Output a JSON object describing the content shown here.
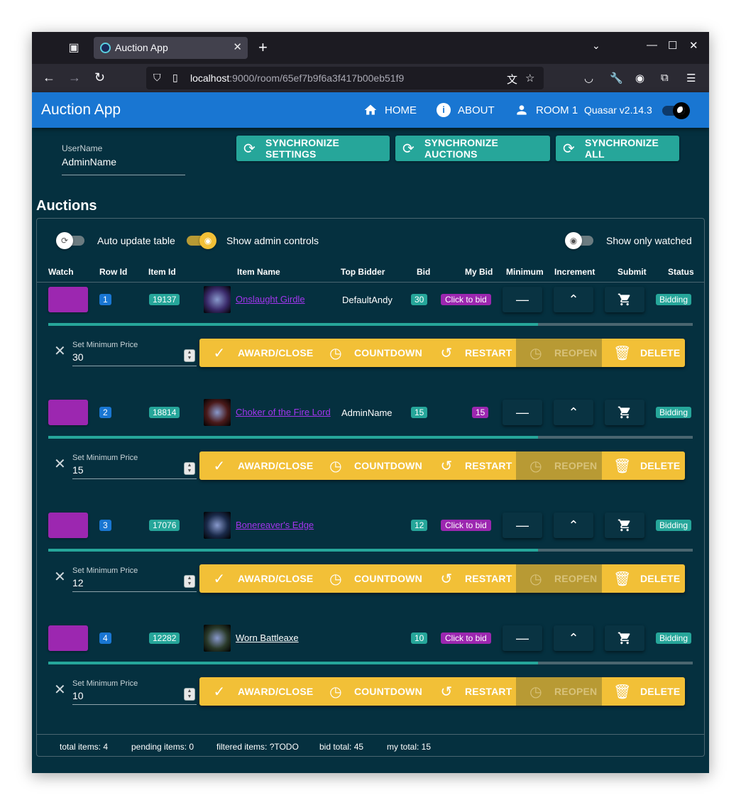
{
  "browser": {
    "tab_title": "Auction App",
    "url_host": "localhost",
    "url_rest": ":9000/room/65ef7b9f6a3f417b00eb51f9"
  },
  "header": {
    "title": "Auction App",
    "nav": {
      "home": "HOME",
      "about": "ABOUT",
      "room": "ROOM 1"
    },
    "version": "Quasar v2.14.3"
  },
  "user": {
    "label": "UserName",
    "value": "AdminName"
  },
  "sync": {
    "settings": "SYNCHRONIZE SETTINGS",
    "auctions": "SYNCHRONIZE AUCTIONS",
    "all": "SYNCHRONIZE ALL"
  },
  "section_title": "Auctions",
  "toggles": {
    "auto_update": "Auto update table",
    "show_admin": "Show admin controls",
    "only_watched": "Show only watched"
  },
  "columns": {
    "watch": "Watch",
    "row_id": "Row Id",
    "item_id": "Item Id",
    "item_name": "Item Name",
    "top_bidder": "Top Bidder",
    "bid": "Bid",
    "my_bid": "My Bid",
    "minimum": "Minimum",
    "increment": "Increment",
    "submit": "Submit",
    "status": "Status"
  },
  "rows": [
    {
      "row_id": "1",
      "item_id": "19137",
      "item_name": "Onslaught Girdle",
      "top_bidder": "DefaultAndy",
      "bid": "30",
      "my_bid": "Click to bid",
      "status": "Bidding",
      "min_label": "Set Minimum Price",
      "min_value": "30",
      "progress": 0.76
    },
    {
      "row_id": "2",
      "item_id": "18814",
      "item_name": "Choker of the Fire Lord",
      "top_bidder": "AdminName",
      "bid": "15",
      "my_bid": "15",
      "status": "Bidding",
      "min_label": "Set Minimum Price",
      "min_value": "15",
      "progress": 0.76
    },
    {
      "row_id": "3",
      "item_id": "17076",
      "item_name": "Bonereaver's Edge",
      "top_bidder": "",
      "bid": "12",
      "my_bid": "Click to bid",
      "status": "Bidding",
      "min_label": "Set Minimum Price",
      "min_value": "12",
      "progress": 0.76
    },
    {
      "row_id": "4",
      "item_id": "12282",
      "item_name": "Worn Battleaxe",
      "top_bidder": "",
      "bid": "10",
      "my_bid": "Click to bid",
      "status": "Bidding",
      "min_label": "Set Minimum Price",
      "min_value": "10",
      "progress": 0.76
    }
  ],
  "actions": {
    "award": "AWARD/CLOSE",
    "countdown": "COUNTDOWN",
    "restart": "RESTART",
    "reopen": "REOPEN",
    "delete": "DELETE"
  },
  "footer": {
    "total": "total items: 4",
    "pending": "pending items: 0",
    "filtered": "filtered items: ?TODO",
    "bid_total": "bid total: 45",
    "my_total": "my total: 15"
  },
  "colors": {
    "primary": "#1976d2",
    "teal": "#26a69a",
    "purple": "#9c27b0",
    "warning": "#f2c037",
    "background": "#05303f",
    "epic_link": "#a335ee",
    "common_link": "#ffffff"
  },
  "icons": {
    "home": "home-icon",
    "about": "info-icon",
    "room": "person-icon",
    "sync": "sync-icon",
    "minus": "minus-icon",
    "up": "chevron-up-icon",
    "cart": "cart-icon",
    "check": "check-icon",
    "timer": "timer-icon",
    "restart": "restart-icon",
    "delete": "trash-icon",
    "close": "close-icon"
  }
}
